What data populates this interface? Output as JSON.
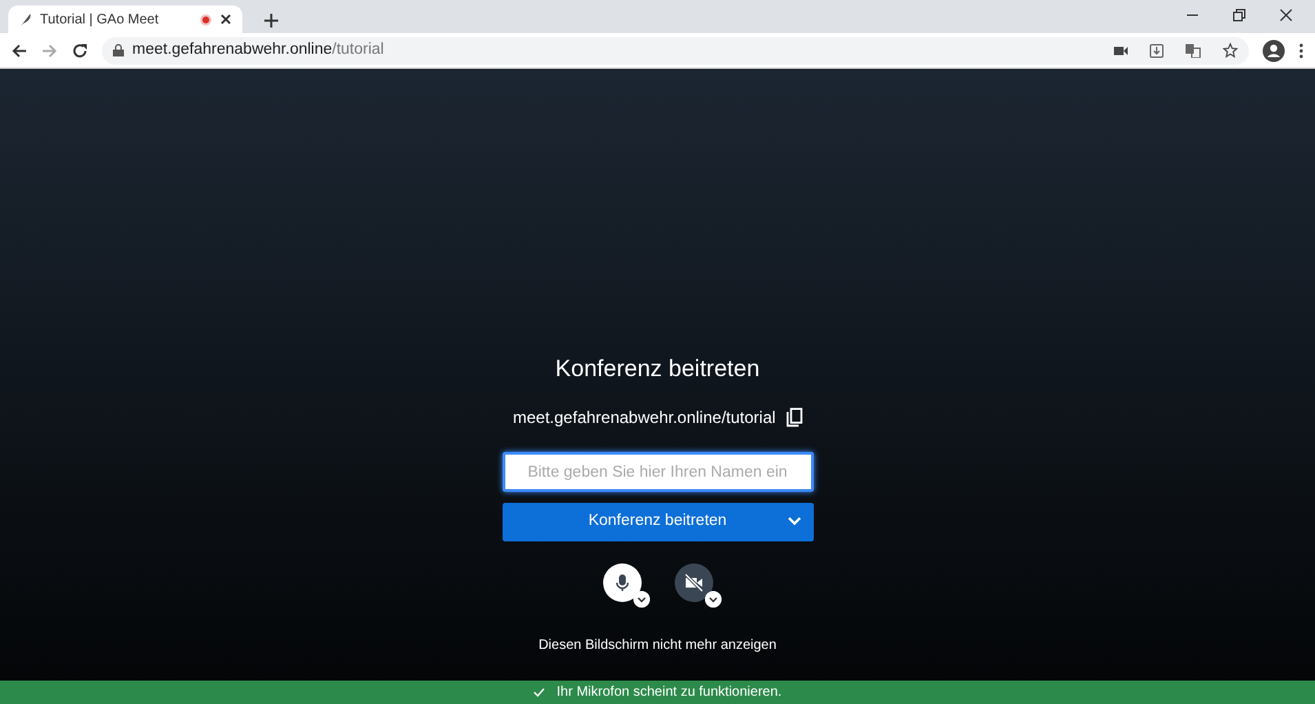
{
  "browser": {
    "tab": {
      "title": "Tutorial | GAo Meet",
      "recording": true
    },
    "url_host": "meet.gefahrenabwehr.online",
    "url_path": "/tutorial"
  },
  "prejoin": {
    "title": "Konferenz beitreten",
    "room_url": "meet.gefahrenabwehr.online/tutorial",
    "name_field": {
      "placeholder": "Bitte geben Sie hier Ihren Namen ein"
    },
    "join_button": "Konferenz beitreten",
    "devices": [
      {
        "kind": "microphone",
        "on": true
      },
      {
        "kind": "camera",
        "on": false
      }
    ],
    "dont_show_again": "Diesen Bildschirm nicht mehr anzeigen"
  },
  "notice": "Ihr Mikrofon scheint zu funktionieren."
}
